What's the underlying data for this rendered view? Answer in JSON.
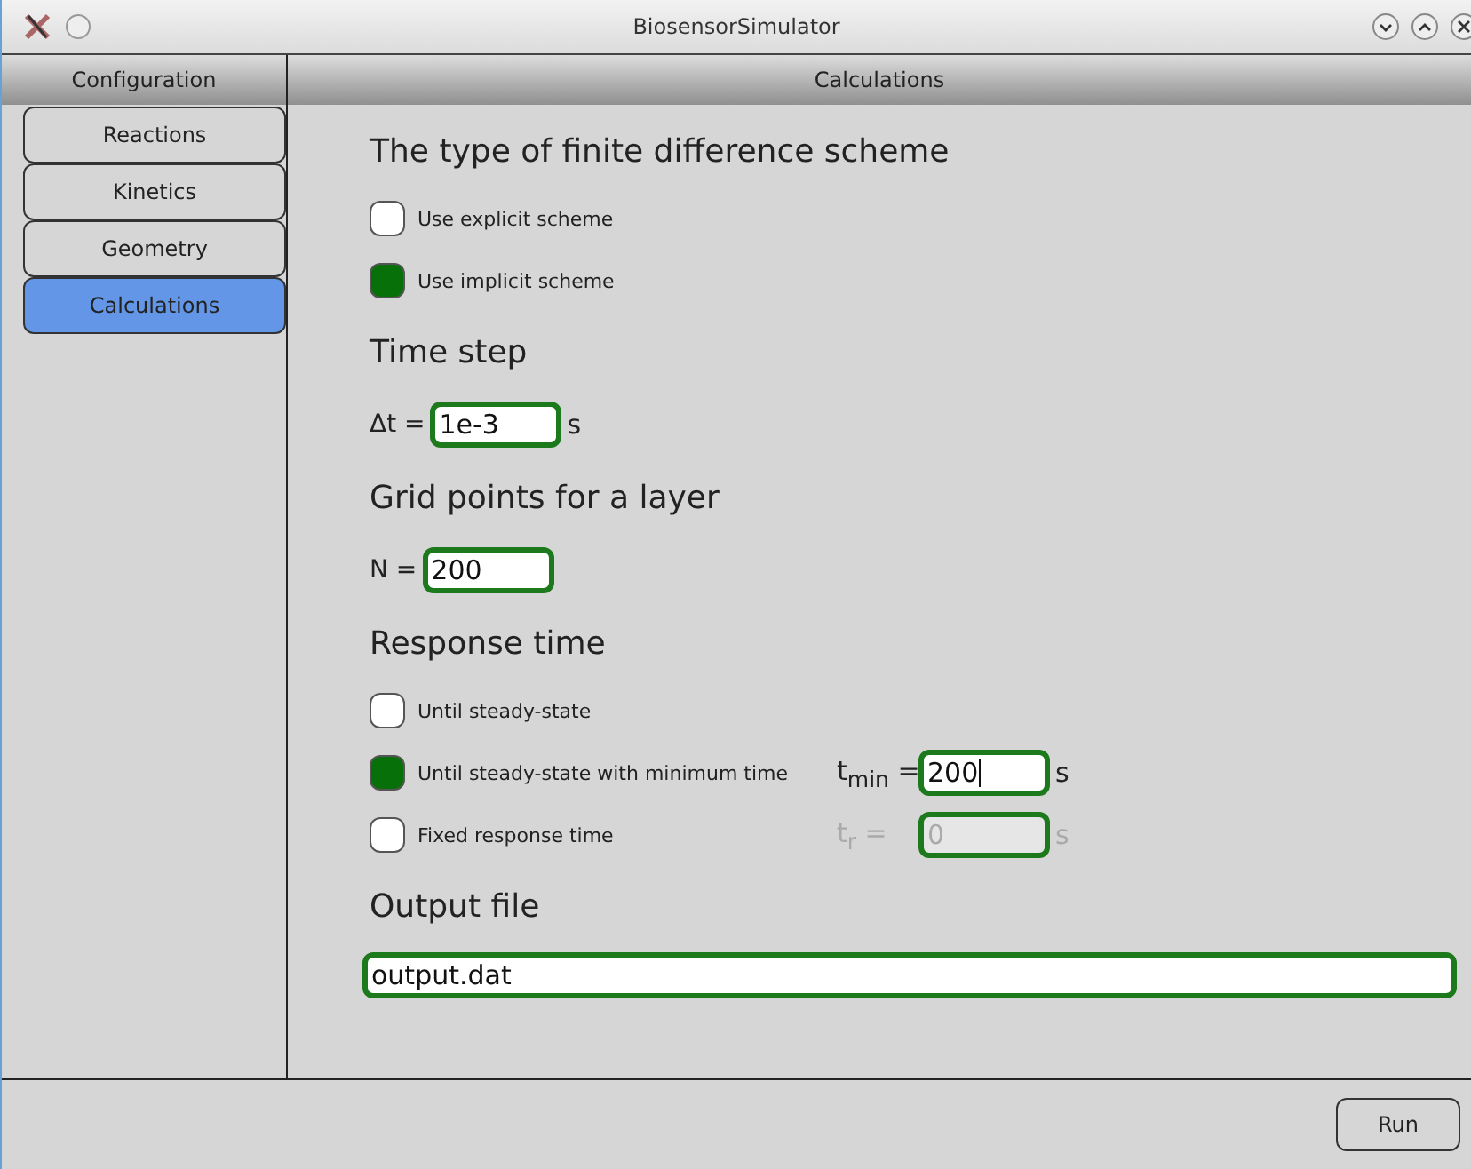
{
  "window": {
    "title": "BiosensorSimulator"
  },
  "sidebar": {
    "title": "Configuration",
    "items": [
      {
        "label": "Reactions",
        "selected": false
      },
      {
        "label": "Kinetics",
        "selected": false
      },
      {
        "label": "Geometry",
        "selected": false
      },
      {
        "label": "Calculations",
        "selected": true
      }
    ]
  },
  "panel": {
    "title": "Calculations",
    "sections": [
      {
        "heading": "The type of finite difference scheme",
        "rows": [
          {
            "kind": "option",
            "label": "Use explicit scheme",
            "checked": false
          },
          {
            "kind": "option",
            "label": "Use implicit scheme",
            "checked": true
          }
        ]
      },
      {
        "heading": "Time step",
        "rows": [
          {
            "kind": "field",
            "label": "Δt =",
            "value": "1e-3",
            "unit": "s"
          }
        ]
      },
      {
        "heading": "Grid points for a layer",
        "rows": [
          {
            "kind": "field",
            "label": "N =",
            "value": "200"
          }
        ]
      },
      {
        "heading": "Response time",
        "rows": [
          {
            "kind": "option",
            "label": "Until steady-state",
            "checked": false
          },
          {
            "kind": "option",
            "label": "Until steady-state with minimum time",
            "checked": true,
            "field": {
              "label": "t$_{min}$ =",
              "value": "200",
              "unit": "s",
              "disabled": false,
              "cursor": true
            }
          },
          {
            "kind": "option",
            "label": "Fixed response time",
            "checked": false,
            "field": {
              "label": "t$_{r}$ =",
              "value": "0",
              "unit": "s",
              "disabled": true,
              "cursor": false
            }
          }
        ]
      },
      {
        "heading": "Output file",
        "rows": [
          {
            "kind": "wide-field",
            "value": "output.dat"
          }
        ]
      }
    ]
  },
  "buttons": [
    {
      "label": "Run"
    }
  ]
}
